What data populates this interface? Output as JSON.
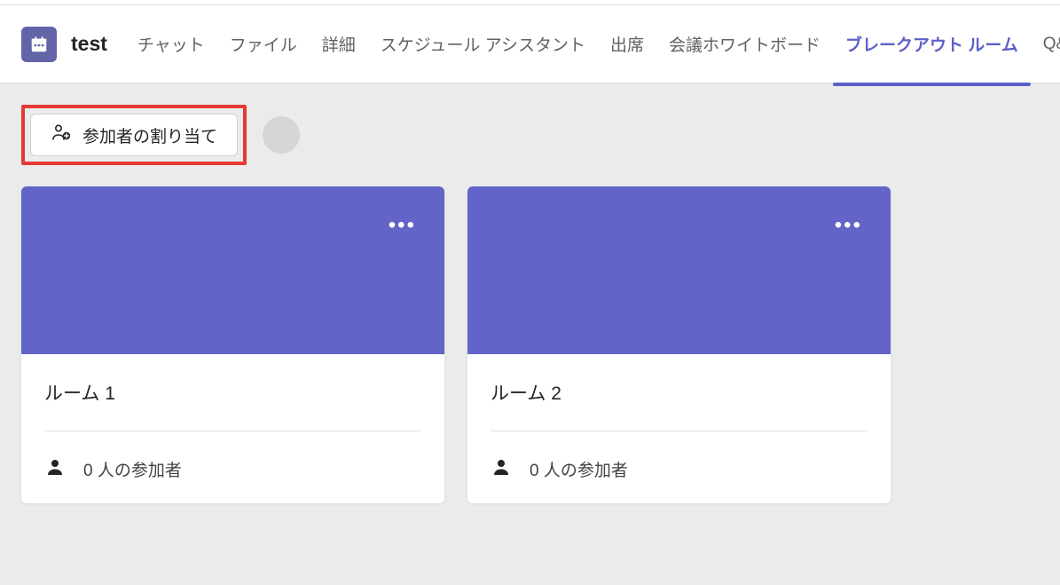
{
  "header": {
    "meeting_title": "test",
    "tabs": [
      {
        "label": "チャット",
        "active": false
      },
      {
        "label": "ファイル",
        "active": false
      },
      {
        "label": "詳細",
        "active": false
      },
      {
        "label": "スケジュール アシスタント",
        "active": false
      },
      {
        "label": "出席",
        "active": false
      },
      {
        "label": "会議ホワイトボード",
        "active": false
      },
      {
        "label": "ブレークアウト ルーム",
        "active": true
      },
      {
        "label": "Q&A",
        "active": false
      }
    ]
  },
  "toolbar": {
    "assign_label": "参加者の割り当て"
  },
  "rooms": [
    {
      "name": "ルーム 1",
      "participants_text": "0 人の参加者"
    },
    {
      "name": "ルーム 2",
      "participants_text": "0 人の参加者"
    }
  ],
  "colors": {
    "accent": "#6264a7",
    "room_header": "#6264c7",
    "highlight": "#e53935",
    "content_bg": "#ebebeb"
  }
}
